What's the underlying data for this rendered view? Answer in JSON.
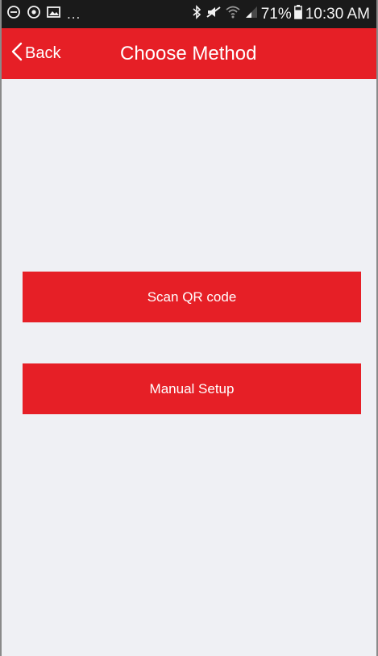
{
  "status_bar": {
    "left_icons": [
      "sync-icon",
      "target-icon",
      "gallery-icon"
    ],
    "left_ellipsis": "...",
    "right_icons": [
      "bluetooth-icon",
      "mute-icon",
      "wifi-icon",
      "signal-icon"
    ],
    "battery_text": "71%",
    "battery_icon": "battery-icon",
    "time": "10:30 AM"
  },
  "header": {
    "back_label": "Back",
    "back_icon": "chevron-left-icon",
    "title": "Choose Method",
    "background": "#e61f26"
  },
  "main": {
    "buttons": [
      {
        "label": "Scan QR code"
      },
      {
        "label": "Manual Setup"
      }
    ],
    "background": "#eff0f4",
    "button_color": "#e61f26"
  }
}
